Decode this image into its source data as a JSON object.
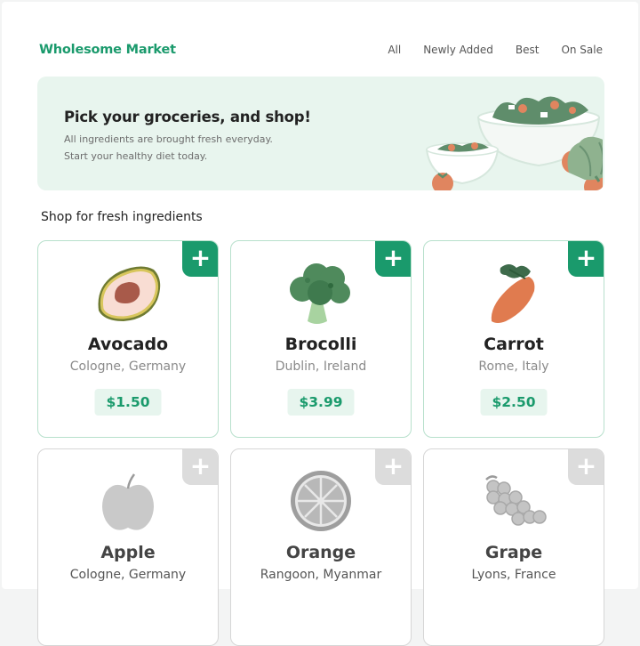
{
  "brand": "Wholesome Market",
  "nav": [
    "All",
    "Newly Added",
    "Best",
    "On Sale"
  ],
  "hero": {
    "title": "Pick your groceries, and shop!",
    "line1": "All ingredients are brought fresh everyday.",
    "line2": "Start your healthy diet today."
  },
  "section_title": "Shop for fresh ingredients",
  "add_symbol": "+",
  "products": [
    {
      "name": "Avocado",
      "location": "Cologne, Germany",
      "price": "$1.50",
      "icon": "avocado-icon",
      "available": true
    },
    {
      "name": "Brocolli",
      "location": "Dublin, Ireland",
      "price": "$3.99",
      "icon": "broccoli-icon",
      "available": true
    },
    {
      "name": "Carrot",
      "location": "Rome, Italy",
      "price": "$2.50",
      "icon": "carrot-icon",
      "available": true
    },
    {
      "name": "Apple",
      "location": "Cologne, Germany",
      "price": "",
      "icon": "apple-icon",
      "available": false
    },
    {
      "name": "Orange",
      "location": "Rangoon, Myanmar",
      "price": "",
      "icon": "orange-icon",
      "available": false
    },
    {
      "name": "Grape",
      "location": "Lyons, France",
      "price": "",
      "icon": "grape-icon",
      "available": false
    }
  ],
  "colors": {
    "accent": "#1a9a6c",
    "hero_bg": "#e8f5ee",
    "card_border": "#b7e0cc",
    "disabled": "#dcdcdc"
  }
}
